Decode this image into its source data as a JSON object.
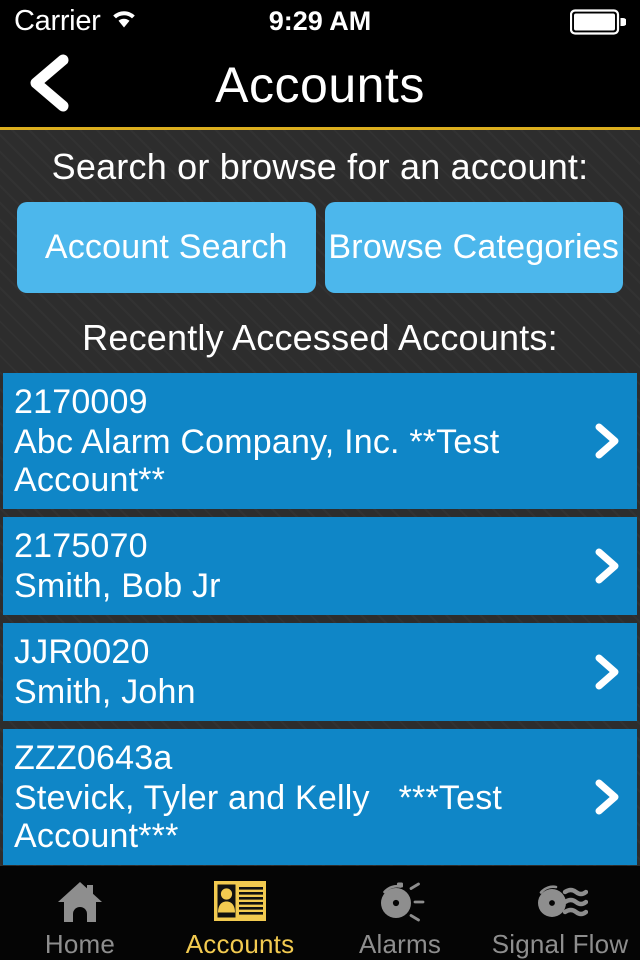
{
  "status_bar": {
    "carrier": "Carrier",
    "wifi_icon": "wifi-icon",
    "time": "9:29 AM",
    "battery_icon": "battery-full-icon"
  },
  "nav_bar": {
    "back_icon": "chevron-left-icon",
    "title": "Accounts",
    "rule_color": "#dcae1e"
  },
  "main": {
    "search_heading": "Search or browse for an account:",
    "buttons": [
      {
        "label": "Account Search",
        "name": "account-search-button"
      },
      {
        "label": "Browse Categories",
        "name": "browse-categories-button"
      }
    ],
    "recent_heading": "Recently Accessed Accounts:",
    "accounts": [
      {
        "number": "2170009",
        "name": "Abc Alarm Company, Inc. **Test Account**"
      },
      {
        "number": "2175070",
        "name": "Smith, Bob Jr"
      },
      {
        "number": "JJR0020",
        "name": "Smith, John"
      },
      {
        "number": "ZZZ0643a",
        "name": "Stevick, Tyler and Kelly   ***Test Account***"
      }
    ],
    "chevron_icon": "chevron-right-icon"
  },
  "tab_bar": {
    "active": "Accounts",
    "active_color": "#f2ca50",
    "inactive_color": "#8e8e8e",
    "tabs": [
      {
        "label": "Home",
        "icon": "house-icon"
      },
      {
        "label": "Accounts",
        "icon": "id-card-icon"
      },
      {
        "label": "Alarms",
        "icon": "alarm-siren-icon"
      },
      {
        "label": "Signal Flow",
        "icon": "signal-waves-icon"
      }
    ]
  },
  "colors": {
    "button_blue": "#4cb7ec",
    "row_blue": "#0f86c7",
    "background_gray": "#2d2d2d",
    "bar_black": "#000000"
  }
}
